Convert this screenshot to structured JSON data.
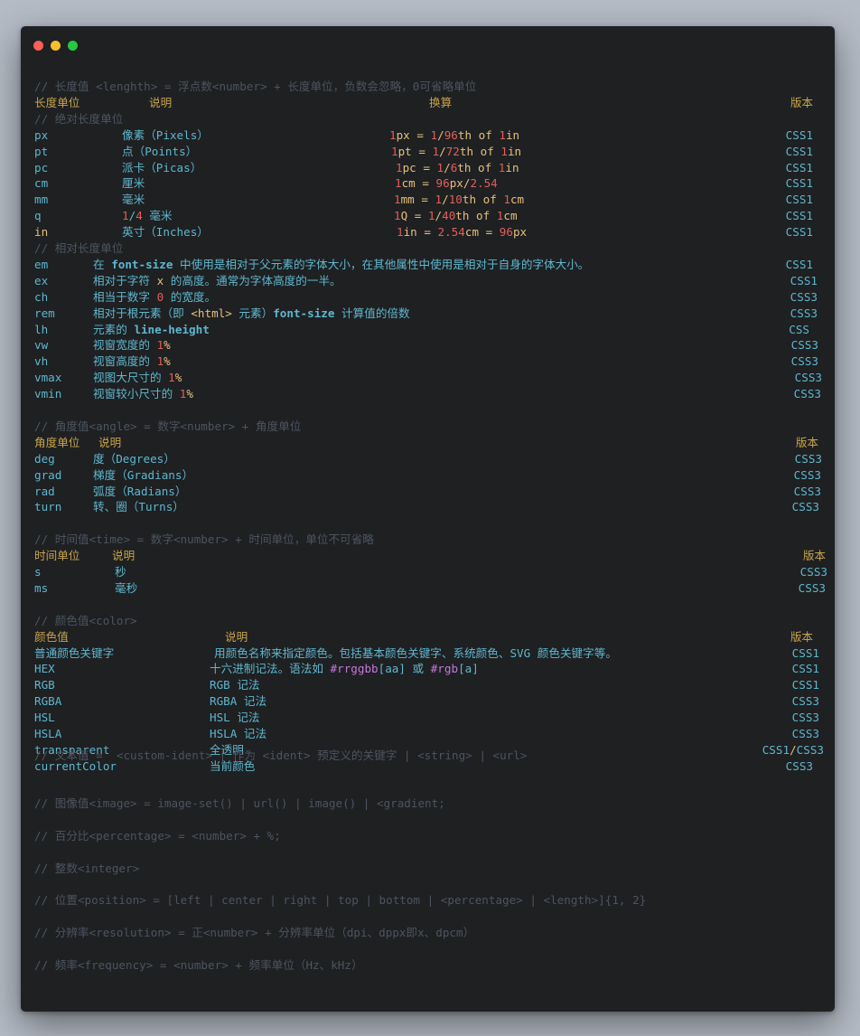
{
  "window": {
    "buttons": [
      "close",
      "minimize",
      "maximize"
    ]
  },
  "length": {
    "comment": "// 长度值 <lenghth> = 浮点数<number> + 长度单位，负数会忽略，0可省略单位",
    "header": {
      "unit": "长度单位",
      "desc": "说明",
      "conv": "换算",
      "version": "版本"
    },
    "abs_comment": "// 绝对长度单位",
    "absolute": [
      {
        "unit": "px",
        "desc": "像素（Pixels）",
        "conv": [
          "1",
          "px = ",
          "1",
          "/",
          "96",
          "th of ",
          "1",
          "in"
        ],
        "version": "CSS1"
      },
      {
        "unit": "pt",
        "desc": "点（Points）",
        "conv": [
          "1",
          "pt = ",
          "1",
          "/",
          "72",
          "th of ",
          "1",
          "in"
        ],
        "version": "CSS1"
      },
      {
        "unit": "pc",
        "desc": "派卡（Picas）",
        "conv": [
          "1",
          "pc = ",
          "1",
          "/",
          "6",
          "th of ",
          "1",
          "in"
        ],
        "version": "CSS1"
      },
      {
        "unit": "cm",
        "desc": "厘米",
        "conv": [
          "1",
          "cm = ",
          "96",
          "px/",
          "2.54"
        ],
        "version": "CSS1"
      },
      {
        "unit": "mm",
        "desc": "毫米",
        "conv": [
          "1",
          "mm = ",
          "1",
          "/",
          "10",
          "th of ",
          "1",
          "cm"
        ],
        "version": "CSS1"
      },
      {
        "unit": "q",
        "desc": [
          "1",
          "/",
          "4",
          " 毫米"
        ],
        "conv": [
          "1",
          "Q = ",
          "1",
          "/",
          "40",
          "th of ",
          "1",
          "cm"
        ],
        "version": "CSS1"
      },
      {
        "unit": "in",
        "desc": "英寸（Inches）",
        "conv": [
          "1",
          "in = ",
          "2.54",
          "cm = ",
          "96",
          "px"
        ],
        "version": "CSS1"
      }
    ],
    "rel_comment": "// 相对长度单位",
    "relative": [
      {
        "unit": "em",
        "desc": [
          "在 ",
          "font-size",
          " 中使用是相对于父元素的字体大小，在其他属性中使用是相对于自身的字体大小。"
        ],
        "version": "CSS1"
      },
      {
        "unit": "ex",
        "desc": [
          "相对于字符 ",
          "x",
          " 的高度。通常为字体高度的一半。"
        ],
        "version": "CSS1"
      },
      {
        "unit": "ch",
        "desc": [
          "相当于数字 ",
          "0",
          " 的宽度。"
        ],
        "version": "CSS3"
      },
      {
        "unit": "rem",
        "desc": [
          "相对于根元素（即 ",
          "<html>",
          " 元素）",
          "font-size",
          " 计算值的倍数"
        ],
        "version": "CSS3"
      },
      {
        "unit": "lh",
        "desc": [
          "元素的 ",
          "line-height"
        ],
        "version": "CSS"
      },
      {
        "unit": "vw",
        "desc": [
          "视窗宽度的 ",
          "1",
          "%"
        ],
        "version": "CSS3"
      },
      {
        "unit": "vh",
        "desc": [
          "视窗高度的 ",
          "1",
          "%"
        ],
        "version": "CSS3"
      },
      {
        "unit": "vmax",
        "desc": [
          "视图大尺寸的 ",
          "1",
          "%"
        ],
        "version": "CSS3"
      },
      {
        "unit": "vmin",
        "desc": [
          "视窗较小尺寸的 ",
          "1",
          "%"
        ],
        "version": "CSS3"
      }
    ]
  },
  "angle": {
    "comment": "// 角度值<angle> = 数字<number> + 角度单位",
    "header": {
      "unit": "角度单位",
      "desc": "说明",
      "version": "版本"
    },
    "rows": [
      {
        "unit": "deg",
        "desc": "度（Degrees）",
        "version": "CSS3"
      },
      {
        "unit": "grad",
        "desc": "梯度（Gradians）",
        "version": "CSS3"
      },
      {
        "unit": "rad",
        "desc": "弧度（Radians）",
        "version": "CSS3"
      },
      {
        "unit": "turn",
        "desc": "转、圈（Turns）",
        "version": "CSS3"
      }
    ]
  },
  "time": {
    "comment": "// 时间值<time> = 数字<number> + 时间单位，单位不可省略",
    "header": {
      "unit": "时间单位",
      "desc": "说明",
      "version": "版本"
    },
    "rows": [
      {
        "unit": "s",
        "desc": "秒",
        "version": "CSS3"
      },
      {
        "unit": "ms",
        "desc": "毫秒",
        "version": "CSS3"
      }
    ]
  },
  "color": {
    "comment": "// 颜色值<color>",
    "header": {
      "unit": "颜色值",
      "desc": "说明",
      "version": "版本"
    },
    "rows": [
      {
        "unit": "普通颜色关键字",
        "desc": "用颜色名称来指定颜色。包括基本颜色关键字、系统颜色、SVG 颜色关键字等。",
        "version": "CSS1"
      },
      {
        "unit": "HEX",
        "desc": [
          "十六进制记法。语法如 ",
          "#rrggbb",
          "[aa]",
          " 或 ",
          "#rgb",
          "[a]"
        ],
        "version": "CSS1"
      },
      {
        "unit": "RGB",
        "desc": "RGB 记法",
        "version": "CSS1"
      },
      {
        "unit": "RGBA",
        "desc": "RGBA 记法",
        "version": "CSS3"
      },
      {
        "unit": "HSL",
        "desc": "HSL 记法",
        "version": "CSS3"
      },
      {
        "unit": "HSLA",
        "desc": "HSLA 记法",
        "version": "CSS3"
      },
      {
        "unit": "transparent",
        "desc": "全透明",
        "version": [
          "CSS1",
          "/",
          "CSS3"
        ]
      },
      {
        "unit": "currentColor",
        "desc": "当前颜色",
        "version": "CSS3"
      }
    ]
  },
  "other_comments": [
    "// 文本值 =  <custom-ident> | 作为 <ident> 预定义的关键字 | <string> | <url>",
    "// 图像值<image> = image-set() | url() | image() | <gradient;",
    "// 百分比<percentage> = <number> + %;",
    "// 整数<integer>",
    "// 位置<position> = [left | center | right | top | bottom | <percentage> | <length>]{1, 2}",
    "// 分辨率<resolution> = 正<number> + 分辨率单位（dpi、dppx即x、dpcm）",
    "// 频率<frequency> = <number> + 频率单位（Hz、kHz）"
  ],
  "colors": {
    "window_bg": "#1e2022",
    "page_bg": "#b4bbc5",
    "comment": "#4d5560",
    "header": "#c7a348",
    "text": "#5fb7cf",
    "number": "#e0605a",
    "keyword": "#e6c07b",
    "hash": "#c678dd"
  }
}
